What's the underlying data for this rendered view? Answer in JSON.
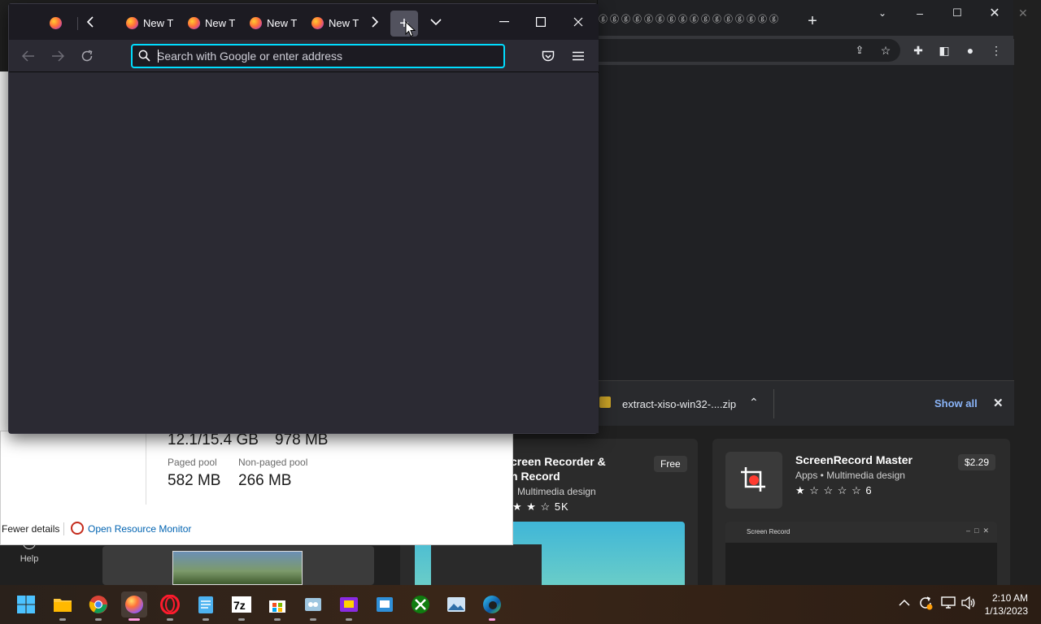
{
  "firefox": {
    "tabs": [
      {
        "label": "New T"
      },
      {
        "label": "New T"
      },
      {
        "label": "New T"
      },
      {
        "label": "New T"
      }
    ],
    "urlbar": {
      "placeholder": "Search with Google or enter address",
      "value": ""
    },
    "colors": {
      "background": "#2b2a33",
      "tabstrip": "#1c1b22",
      "focus_ring": "#00ddff"
    }
  },
  "chrome": {
    "download": {
      "filename": "extract-xiso-win32-....zip",
      "show_all": "Show all"
    }
  },
  "taskmgr": {
    "committed": "12.1/15.4 GB",
    "cached": "978 MB",
    "paged_pool_label": "Paged pool",
    "paged_pool": "582 MB",
    "nonpaged_pool_label": "Non-paged pool",
    "nonpaged_pool": "266 MB",
    "fewer_details": "Fewer details",
    "open_resource_monitor": "Open Resource Monitor"
  },
  "store": {
    "help_label": "Help",
    "card1": {
      "title_line1": "creen Recorder &",
      "title_line2": "n Record",
      "category": "Multimedia design",
      "rating_count": "5K",
      "price": "Free"
    },
    "card2": {
      "title": "ScreenRecord Master",
      "category": "Apps • Multimedia design",
      "rating_count": "6",
      "price": "$2.29",
      "preview_title": "Screen Record"
    }
  },
  "taskbar": {
    "items": [
      "windows-start",
      "file-explorer",
      "chrome",
      "firefox",
      "opera",
      "notepad",
      "7zip",
      "microsoft-store",
      "snipping",
      "app-purple",
      "remote-desktop",
      "xbox",
      "photos",
      "edge"
    ],
    "active_index": 3
  },
  "clock": {
    "time": "2:10 AM",
    "date": "1/13/2023"
  }
}
